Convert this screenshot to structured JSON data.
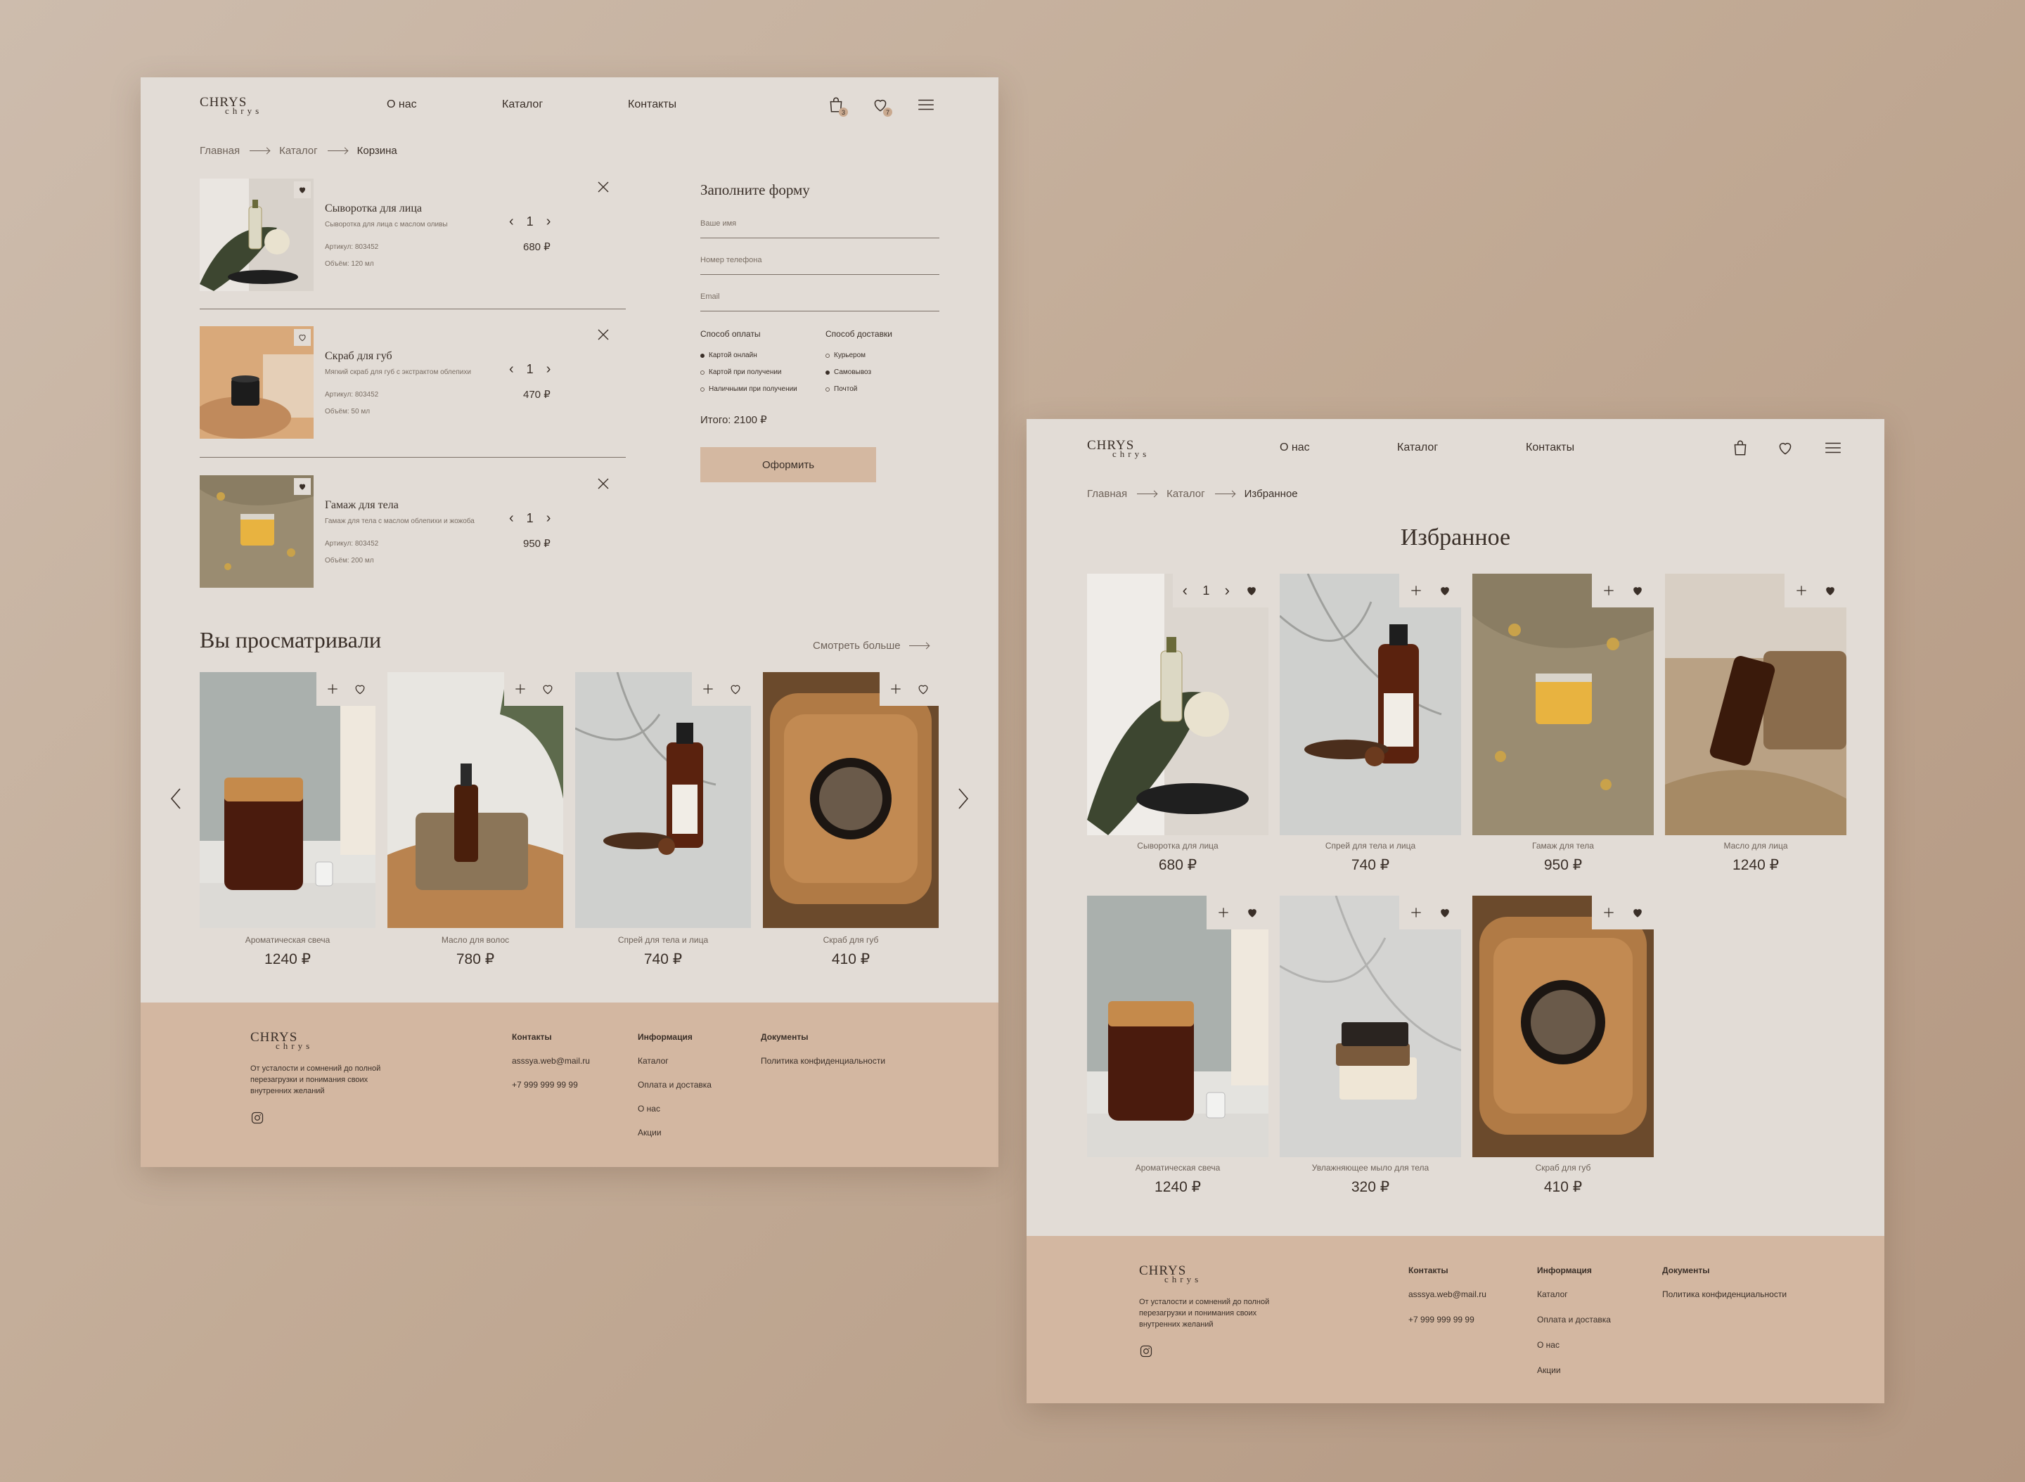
{
  "colors": {
    "background": "#c2ab96",
    "page": "#e2dcd6",
    "footer": "#d3b7a1",
    "button": "#d4b8a1",
    "text": "#3a2f28"
  },
  "logo": {
    "line1": "CHRYS",
    "line2": "chrys"
  },
  "nav": {
    "about": "О нас",
    "catalog": "Каталог",
    "contacts": "Контакты"
  },
  "cart_page": {
    "header": {
      "cart_count": "3",
      "fav_count": "7"
    },
    "breadcrumbs": {
      "home": "Главная",
      "catalog": "Каталог",
      "current": "Корзина"
    },
    "items": [
      {
        "name": "Сыворотка для лица",
        "desc": "Сыворотка для лица с маслом оливы",
        "sku": "Артикул: 803452",
        "volume": "Объём: 120 мл",
        "qty": "1",
        "price": "680 ₽"
      },
      {
        "name": "Скраб для губ",
        "desc": "Мягкий скраб для губ с экстрактом облепихи",
        "sku": "Артикул: 803452",
        "volume": "Объём: 50 мл",
        "qty": "1",
        "price": "470 ₽"
      },
      {
        "name": "Гамаж для тела",
        "desc": "Гамаж для тела с маслом облепихи и жожоба",
        "sku": "Артикул: 803452",
        "volume": "Объём: 200 мл",
        "qty": "1",
        "price": "950 ₽"
      }
    ],
    "form": {
      "title": "Заполните форму",
      "name_placeholder": "Ваше имя",
      "phone_placeholder": "Номер телефона",
      "email_placeholder": "Email",
      "payment_title": "Способ оплаты",
      "payment_options": [
        "Картой онлайн",
        "Картой при получении",
        "Наличными при получении"
      ],
      "delivery_title": "Способ доставки",
      "delivery_options": [
        "Курьером",
        "Самовывоз",
        "Почтой"
      ],
      "total": "Итого: 2100 ₽",
      "submit": "Оформить"
    },
    "viewed": {
      "title": "Вы просматривали",
      "more": "Смотреть больше",
      "products": [
        {
          "name": "Ароматическая свеча",
          "price": "1240 ₽"
        },
        {
          "name": "Масло для волос",
          "price": "780 ₽"
        },
        {
          "name": "Спрей для тела и лица",
          "price": "740 ₽"
        },
        {
          "name": "Скраб для губ",
          "price": "410 ₽"
        }
      ]
    }
  },
  "fav_page": {
    "breadcrumbs": {
      "home": "Главная",
      "catalog": "Каталог",
      "current": "Избранное"
    },
    "title": "Избранное",
    "first_qty": "1",
    "products": [
      {
        "name": "Сыворотка для лица",
        "price": "680 ₽"
      },
      {
        "name": "Спрей для тела и лица",
        "price": "740 ₽"
      },
      {
        "name": "Гамаж для тела",
        "price": "950 ₽"
      },
      {
        "name": "Масло для лица",
        "price": "1240 ₽"
      },
      {
        "name": "Ароматическая свеча",
        "price": "1240 ₽"
      },
      {
        "name": "Увлажняющее мыло для тела",
        "price": "320 ₽"
      },
      {
        "name": "Скраб для губ",
        "price": "410 ₽"
      }
    ]
  },
  "footer": {
    "tagline": "От усталости и сомнений до полной перезагрузки и понимания своих внутренних желаний",
    "contacts_title": "Контакты",
    "email": "asssya.web@mail.ru",
    "phone": "+7 999 999 99 99",
    "info_title": "Информация",
    "info_links": [
      "Каталог",
      "Оплата и доставка",
      "О нас",
      "Акции"
    ],
    "docs_title": "Документы",
    "docs_link": "Политика конфиденциальности"
  }
}
